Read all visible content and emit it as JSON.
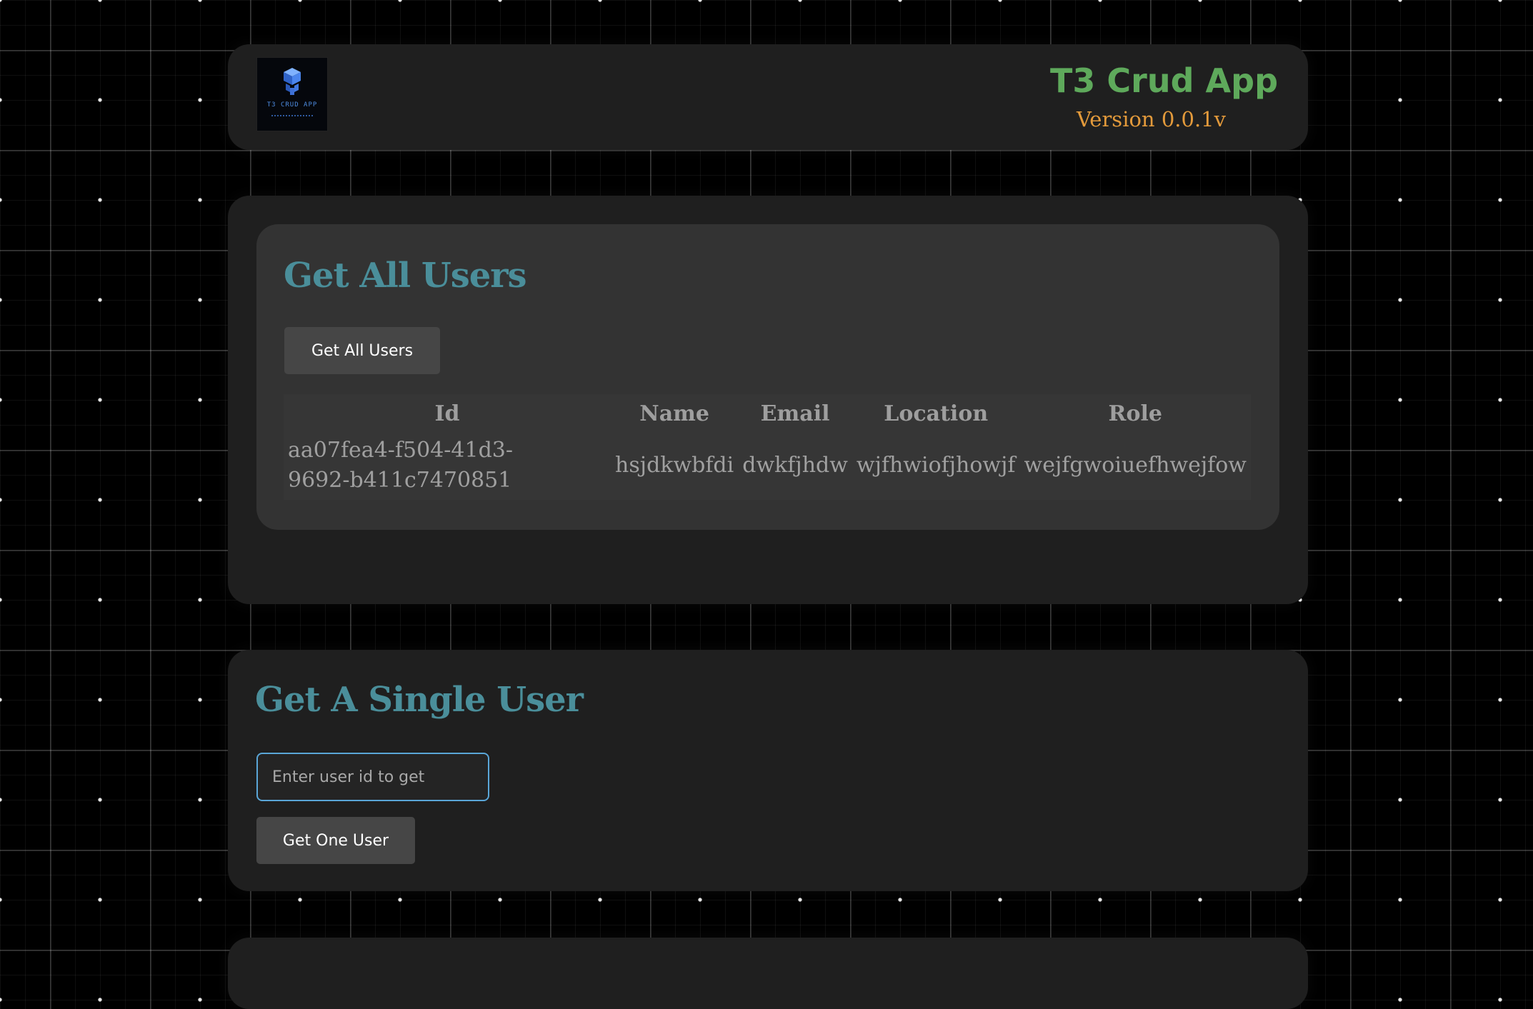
{
  "header": {
    "title": "T3 Crud App",
    "version": "Version 0.0.1v",
    "logo": {
      "icon": "cube-stack-icon",
      "text": "T3 CRUD APP"
    }
  },
  "get_all_users": {
    "title": "Get All Users",
    "button_label": "Get All Users",
    "table": {
      "columns": [
        "Id",
        "Name",
        "Email",
        "Location",
        "Role"
      ],
      "rows": [
        {
          "id": "aa07fea4-f504-41d3-9692-b411c7470851",
          "name": "hsjdkwbfdi",
          "email": "dwkfjhdw",
          "location": "wjfhwiofjhowjf",
          "role": "wejfgwoiuefhwejfow"
        }
      ]
    }
  },
  "get_single_user": {
    "title": "Get A Single User",
    "input_placeholder": "Enter user id to get",
    "button_label": "Get One User"
  },
  "colors": {
    "page_bg": "#000000",
    "panel_bg": "#1f1f1f",
    "card_bg": "#333333",
    "title_green": "#5ea95b",
    "version_orange": "#e39a3b",
    "section_title_teal": "#4a8e9a",
    "input_border_blue": "#5aa6d8"
  }
}
